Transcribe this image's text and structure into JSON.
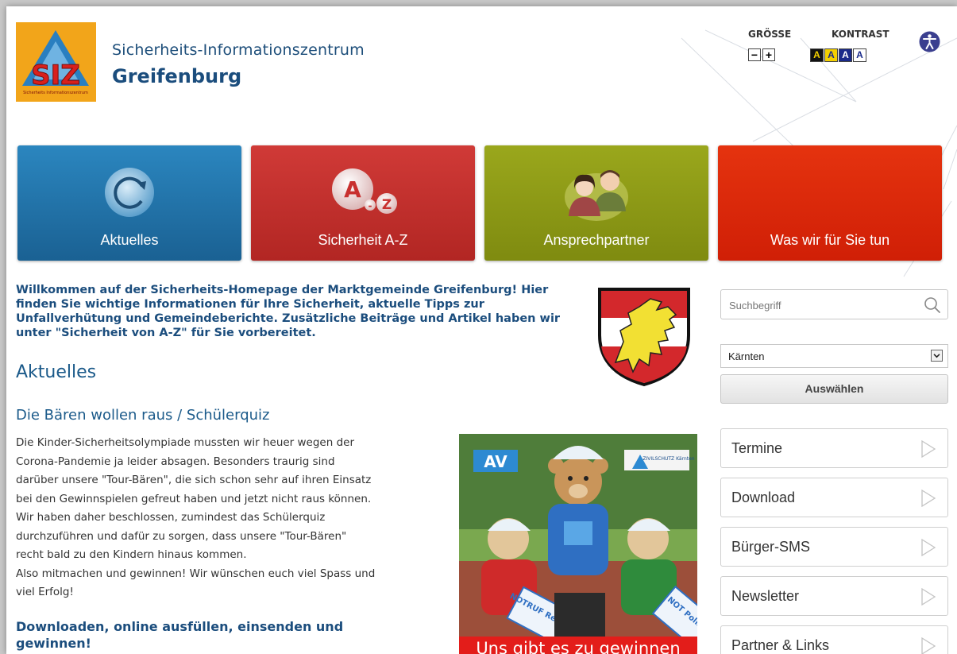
{
  "header": {
    "logo_text": "SIZ",
    "logo_small_text": "Sicherheits Informationszentrum",
    "subtitle": "Sicherheits-Informationszentrum",
    "title": "Greifenburg",
    "size_label": "GRÖSSE",
    "size_minus": "−",
    "size_plus": "+",
    "contrast_label": "KONTRAST",
    "contrast_options": [
      {
        "label": "A",
        "bg": "#111111",
        "fg": "#f4d000"
      },
      {
        "label": "A",
        "bg": "#f4d000",
        "fg": "#1a2a8a"
      },
      {
        "label": "A",
        "bg": "#1a2a8a",
        "fg": "#ffffff"
      },
      {
        "label": "A",
        "bg": "#ffffff",
        "fg": "#1a2a8a"
      }
    ],
    "accessibility_icon": "accessibility-icon"
  },
  "tiles": [
    {
      "label": "Aktuelles",
      "icon": "refresh-icon",
      "color": "#1f74a8"
    },
    {
      "label": "Sicherheit A-Z",
      "icon": "a-z-icon",
      "color": "#c8302f"
    },
    {
      "label": "Ansprechpartner",
      "icon": "contacts-icon",
      "color": "#8e9a14"
    },
    {
      "label": "Was wir für Sie tun",
      "icon": "",
      "color": "#dc2b0b"
    }
  ],
  "main": {
    "intro": "Willkommen auf der Sicherheits-Homepage der Marktgemeinde Greifenburg! Hier finden Sie wichtige Informationen für Ihre Sicherheit, aktuelle Tipps zur Unfallverhütung und Gemeindeberichte. Zusätzliche Beiträge und Artikel haben wir unter \"Sicherheit von A-Z\" für Sie vorbereitet.",
    "section_title": "Aktuelles",
    "article_title": "Die Bären wollen raus / Schülerquiz",
    "article_body": "Die Kinder-Sicherheitsolympiade mussten wir heuer wegen der\nCorona-Pandemie ja leider absagen. Besonders traurig sind\ndarüber unsere \"Tour-Bären\", die sich schon sehr auf ihren Einsatz\nbei den Gewinnspielen gefreut haben und jetzt nicht raus können.\nWir haben daher beschlossen, zumindest das Schülerquiz\ndurchzuführen und dafür zu sorgen, dass unsere \"Tour-Bären\"\nrecht bald zu den Kindern hinaus kommen.\nAlso mitmachen und gewinnen! Wir wünschen euch viel Spass und\nviel Erfolg!",
    "download_heading": "Downloaden, online ausfüllen, einsenden und gewinnen!",
    "promo": {
      "av_text": "AV",
      "zivilschutz_text": "ZIVILSCHUTZ Kärnten",
      "sign1_text": "NOTRUF Rettung",
      "sign2_text": "NOT Poliz",
      "caption": "Uns gibt es zu gewinnen"
    }
  },
  "sidebar": {
    "search_placeholder": "Suchbegriff",
    "region_value": "Kärnten",
    "select_button": "Auswählen",
    "links": [
      {
        "label": "Termine"
      },
      {
        "label": "Download"
      },
      {
        "label": "Bürger-SMS"
      },
      {
        "label": "Newsletter"
      },
      {
        "label": "Partner & Links"
      }
    ]
  }
}
